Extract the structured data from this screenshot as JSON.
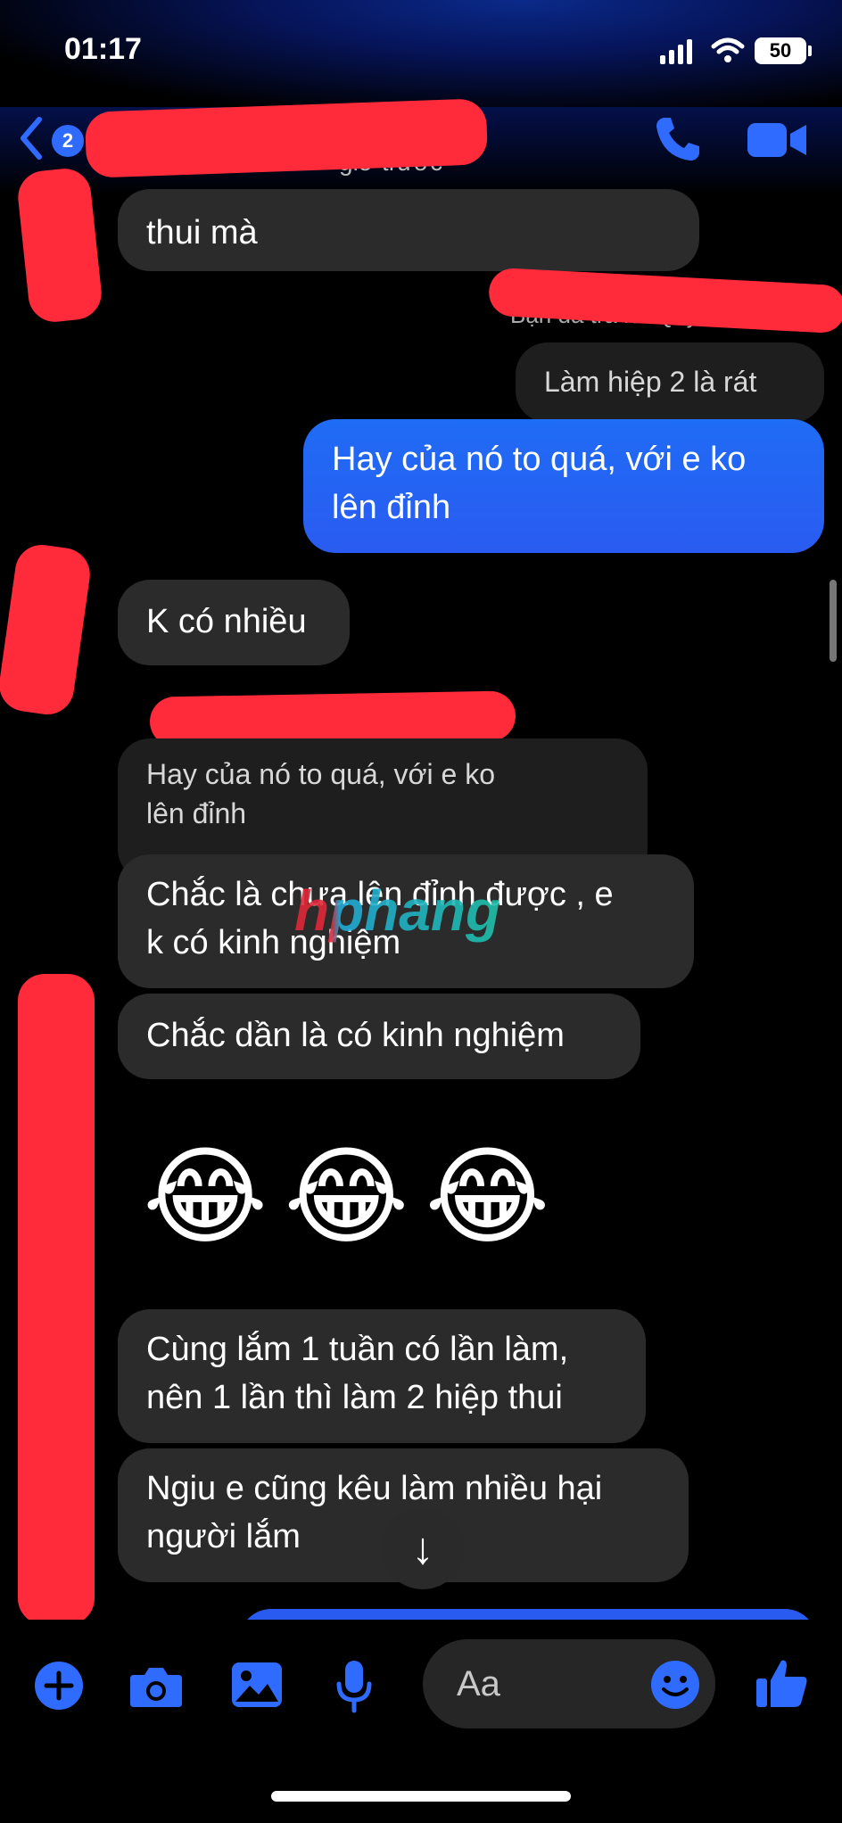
{
  "status_bar": {
    "time": "01:17",
    "battery": "50"
  },
  "header": {
    "back_badge": "2",
    "active_status": "giờ trước"
  },
  "messages": [
    {
      "id": "m1",
      "text": "thui mà"
    },
    {
      "id": "reply_label_1",
      "text": "Bạn đã trả lời Quỳnh"
    },
    {
      "id": "m2_quote",
      "text": "Làm hiệp 2 là rát"
    },
    {
      "id": "m3",
      "text": "Hay của nó to quá, với e ko\nlên đỉnh"
    },
    {
      "id": "m4",
      "text": "K có nhiều"
    },
    {
      "id": "m5_quote",
      "text": "Hay của nó to quá, với e ko\nlên đỉnh"
    },
    {
      "id": "m6",
      "text": "Chắc là chưa lên đỉnh được , e\nk có kinh nghiệm"
    },
    {
      "id": "m7",
      "text": "Chắc dần là có kinh nghiệm"
    },
    {
      "id": "m8",
      "text": "😂😂😂"
    },
    {
      "id": "m9",
      "text": "Cùng lắm 1 tuần có lần làm,\nnên 1 lần thì làm 2 hiệp thui"
    },
    {
      "id": "m10",
      "text": "Ngiu e cũng kêu làm nhiều hại\nngười lắm"
    }
  ],
  "watermark": "hphang",
  "scroll_down_glyph": "↓",
  "composer": {
    "placeholder": "Aa"
  },
  "icons": [
    "back-chevron-icon",
    "phone-icon",
    "video-camera-icon",
    "plus-icon",
    "camera-icon",
    "photo-icon",
    "microphone-icon",
    "emoji-icon",
    "thumbs-up-icon",
    "scroll-down-icon"
  ],
  "colors": {
    "accent": "#2f6bff",
    "incoming_bubble": "#2b2b2b",
    "outgoing_bubble": "#1f6cf6",
    "redaction": "#ff2a3a"
  }
}
